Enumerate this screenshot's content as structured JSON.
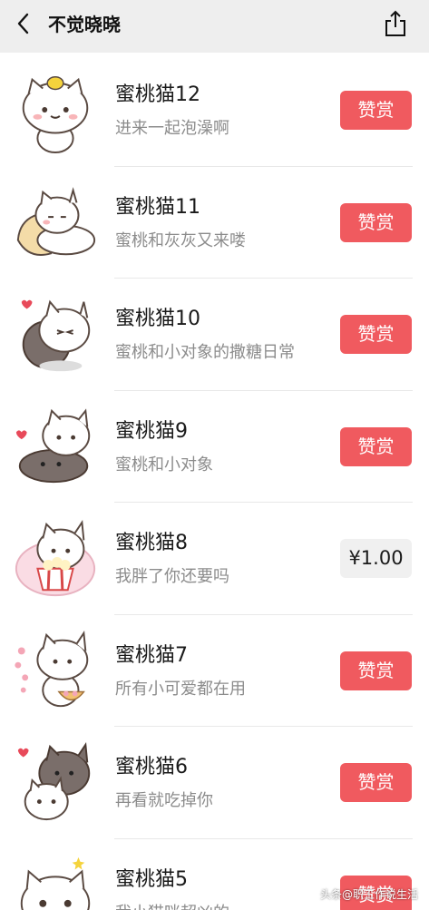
{
  "header": {
    "title": "不觉晓晓"
  },
  "items": [
    {
      "name": "蜜桃猫12",
      "desc": "进来一起泡澡啊",
      "action": "赞赏"
    },
    {
      "name": "蜜桃猫11",
      "desc": "蜜桃和灰灰又来喽",
      "action": "赞赏"
    },
    {
      "name": "蜜桃猫10",
      "desc": "蜜桃和小对象的撒糖日常",
      "action": "赞赏"
    },
    {
      "name": "蜜桃猫9",
      "desc": "蜜桃和小对象",
      "action": "赞赏"
    },
    {
      "name": "蜜桃猫8",
      "desc": "我胖了你还要吗",
      "action": "¥1.00"
    },
    {
      "name": "蜜桃猫7",
      "desc": "所有小可爱都在用",
      "action": "赞赏"
    },
    {
      "name": "蜜桃猫6",
      "desc": "再看就吃掉你",
      "action": "赞赏"
    },
    {
      "name": "蜜桃猫5",
      "desc": "我小猫咪超凶的",
      "action": "赞赏"
    }
  ],
  "watermark": "头条@职工作说生活",
  "colors": {
    "topbar": "#eeeeee",
    "reward_button": "#f05a5f",
    "price_button": "#f0f0f0"
  }
}
